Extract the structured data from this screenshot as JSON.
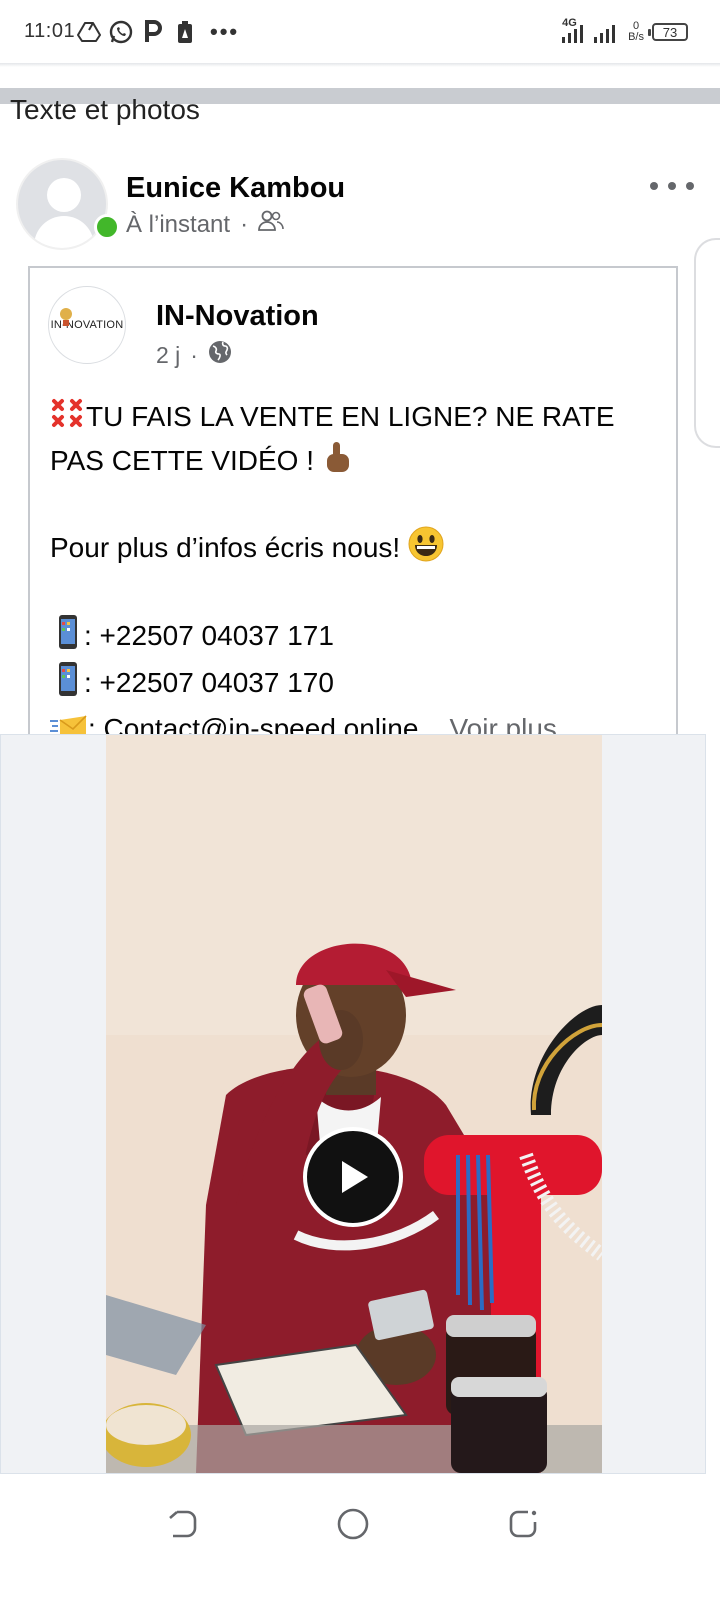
{
  "status_bar": {
    "time": "11:01",
    "network_type": "4G",
    "data_rate_value": "0",
    "data_rate_unit": "B/s",
    "battery_level": "73",
    "icons": [
      "drive-icon",
      "whatsapp-icon",
      "parking-icon",
      "battery-saver-icon",
      "more-dots-icon",
      "signal-icon",
      "battery-icon"
    ]
  },
  "section": {
    "title": "Texte et photos"
  },
  "post": {
    "author_name": "Eunice Kambou",
    "timestamp": "À l’instant",
    "separator": "·",
    "audience_icon": "friends-icon",
    "status_color": "#42b72a"
  },
  "shared": {
    "page_name": "IN-Novation",
    "logo_text": "IN-NOVATION",
    "timestamp": "2 j",
    "separator": "·",
    "audience_icon": "globe-icon",
    "lines": {
      "l1": "TU FAIS LA VENTE EN LIGNE? NE RATE",
      "l2": "PAS CETTE VIDÉO !",
      "l3": "Pour plus d’infos écris nous!",
      "l4": ": +22507 04037 171",
      "l5": ": +22507 04037 170",
      "l6": ": Contact@in-speed.online",
      "ellipsis": "...",
      "see_more": " Voir plus"
    }
  },
  "video": {
    "control_icon": "play-icon"
  },
  "nav": {
    "icons": [
      "back-icon",
      "home-icon",
      "recents-icon"
    ]
  }
}
